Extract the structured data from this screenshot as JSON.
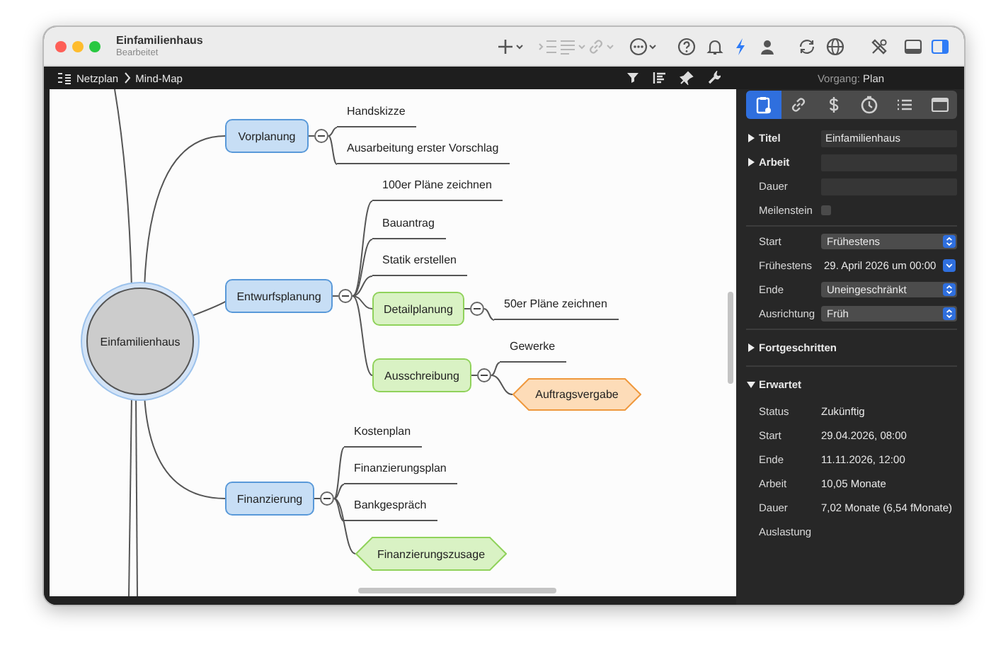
{
  "window": {
    "title": "Einfamilienhaus",
    "subtitle": "Bearbeitet"
  },
  "toolbar": [
    {
      "menu": true,
      "disabled": false,
      "selected": false
    },
    {
      "menu": false,
      "disabled": true,
      "selected": false
    },
    {
      "menu": true,
      "disabled": true,
      "selected": false
    },
    {
      "menu": true,
      "disabled": true,
      "selected": false
    },
    {
      "menu": true,
      "disabled": false,
      "selected": false
    },
    {
      "menu": false,
      "disabled": false,
      "selected": false
    },
    {
      "menu": false,
      "disabled": false,
      "selected": false
    },
    {
      "menu": false,
      "disabled": false,
      "selected": true
    },
    {
      "menu": false,
      "disabled": false,
      "selected": false
    },
    {
      "menu": false,
      "disabled": false,
      "selected": false
    },
    {
      "menu": false,
      "disabled": false,
      "selected": false
    },
    {
      "menu": false,
      "disabled": false,
      "selected": false
    },
    {
      "menu": false,
      "disabled": false,
      "selected": false
    },
    {
      "menu": false,
      "disabled": false,
      "selected": true
    }
  ],
  "breadcrumb": [
    "Netzplan",
    "Mind-Map"
  ],
  "mind_map": {
    "label": "Einfamilienhaus",
    "kind": "root",
    "color": "#cccccc",
    "children": [
      {
        "label": "Vorplanung",
        "kind": "topic",
        "color": "#c7def5",
        "expanded": true,
        "children": [
          {
            "label": "Handskizze",
            "kind": "task"
          },
          {
            "label": "Ausarbeitung erster Vorschlag",
            "kind": "task"
          }
        ]
      },
      {
        "label": "Entwurfsplanung",
        "kind": "topic",
        "color": "#c7def5",
        "expanded": true,
        "children": [
          {
            "label": "100er Pläne zeichnen",
            "kind": "task"
          },
          {
            "label": "Bauantrag",
            "kind": "task"
          },
          {
            "label": "Statik erstellen",
            "kind": "task"
          },
          {
            "label": "Detailplanung",
            "kind": "topic",
            "color": "#d9f2c4",
            "expanded": true,
            "children": [
              {
                "label": "50er Pläne zeichnen",
                "kind": "task"
              }
            ]
          },
          {
            "label": "Ausschreibung",
            "kind": "topic",
            "color": "#d9f2c4",
            "expanded": true,
            "children": [
              {
                "label": "Gewerke",
                "kind": "task"
              },
              {
                "label": "Auftragsvergabe",
                "kind": "milestone",
                "color": "#fddcb8"
              }
            ]
          }
        ]
      },
      {
        "label": "Finanzierung",
        "kind": "topic",
        "color": "#c7def5",
        "expanded": true,
        "children": [
          {
            "label": "Kostenplan",
            "kind": "task"
          },
          {
            "label": "Finanzierungsplan",
            "kind": "task"
          },
          {
            "label": "Bankgespräch",
            "kind": "task"
          },
          {
            "label": "Finanzierungszusage",
            "kind": "milestone",
            "color": "#d9f2c4"
          }
        ]
      }
    ]
  },
  "inspector": {
    "heading_label": "Vorgang:",
    "heading_value": "Plan",
    "tabs": [
      {
        "selected": true
      },
      {
        "selected": false
      },
      {
        "selected": false
      },
      {
        "selected": false
      },
      {
        "selected": false
      },
      {
        "selected": false
      }
    ],
    "rows": [
      {
        "kind": "section-field",
        "label": "Titel",
        "expanded": false,
        "value": "Einfamilienhaus"
      },
      {
        "kind": "section-field",
        "label": "Arbeit",
        "expanded": false
      },
      {
        "kind": "field",
        "label": "Dauer"
      },
      {
        "kind": "checkbox",
        "label": "Meilenstein",
        "checked": false
      },
      {
        "kind": "divider"
      },
      {
        "kind": "popup",
        "label": "Start",
        "value": "Frühestens"
      },
      {
        "kind": "date",
        "label": "Frühestens",
        "value": "29. April 2026 um 00:00"
      },
      {
        "kind": "popup",
        "label": "Ende",
        "value": "Uneingeschränkt"
      },
      {
        "kind": "popup",
        "label": "Ausrichtung",
        "value": "Früh"
      },
      {
        "kind": "divider"
      },
      {
        "kind": "section",
        "label": "Fortgeschritten",
        "expanded": false
      },
      {
        "kind": "divider"
      },
      {
        "kind": "section",
        "label": "Erwartet",
        "expanded": true
      },
      {
        "kind": "info",
        "label": "Status",
        "value": "Zukünftig"
      },
      {
        "kind": "info",
        "label": "Start",
        "value": "29.04.2026, 08:00"
      },
      {
        "kind": "info",
        "label": "Ende",
        "value": "11.11.2026, 12:00"
      },
      {
        "kind": "info",
        "label": "Arbeit",
        "value": "10,05 Monate"
      },
      {
        "kind": "info",
        "label": "Dauer",
        "value": "7,02 Monate (6,54 fMonate)"
      },
      {
        "kind": "info",
        "label": "Auslastung"
      }
    ]
  }
}
